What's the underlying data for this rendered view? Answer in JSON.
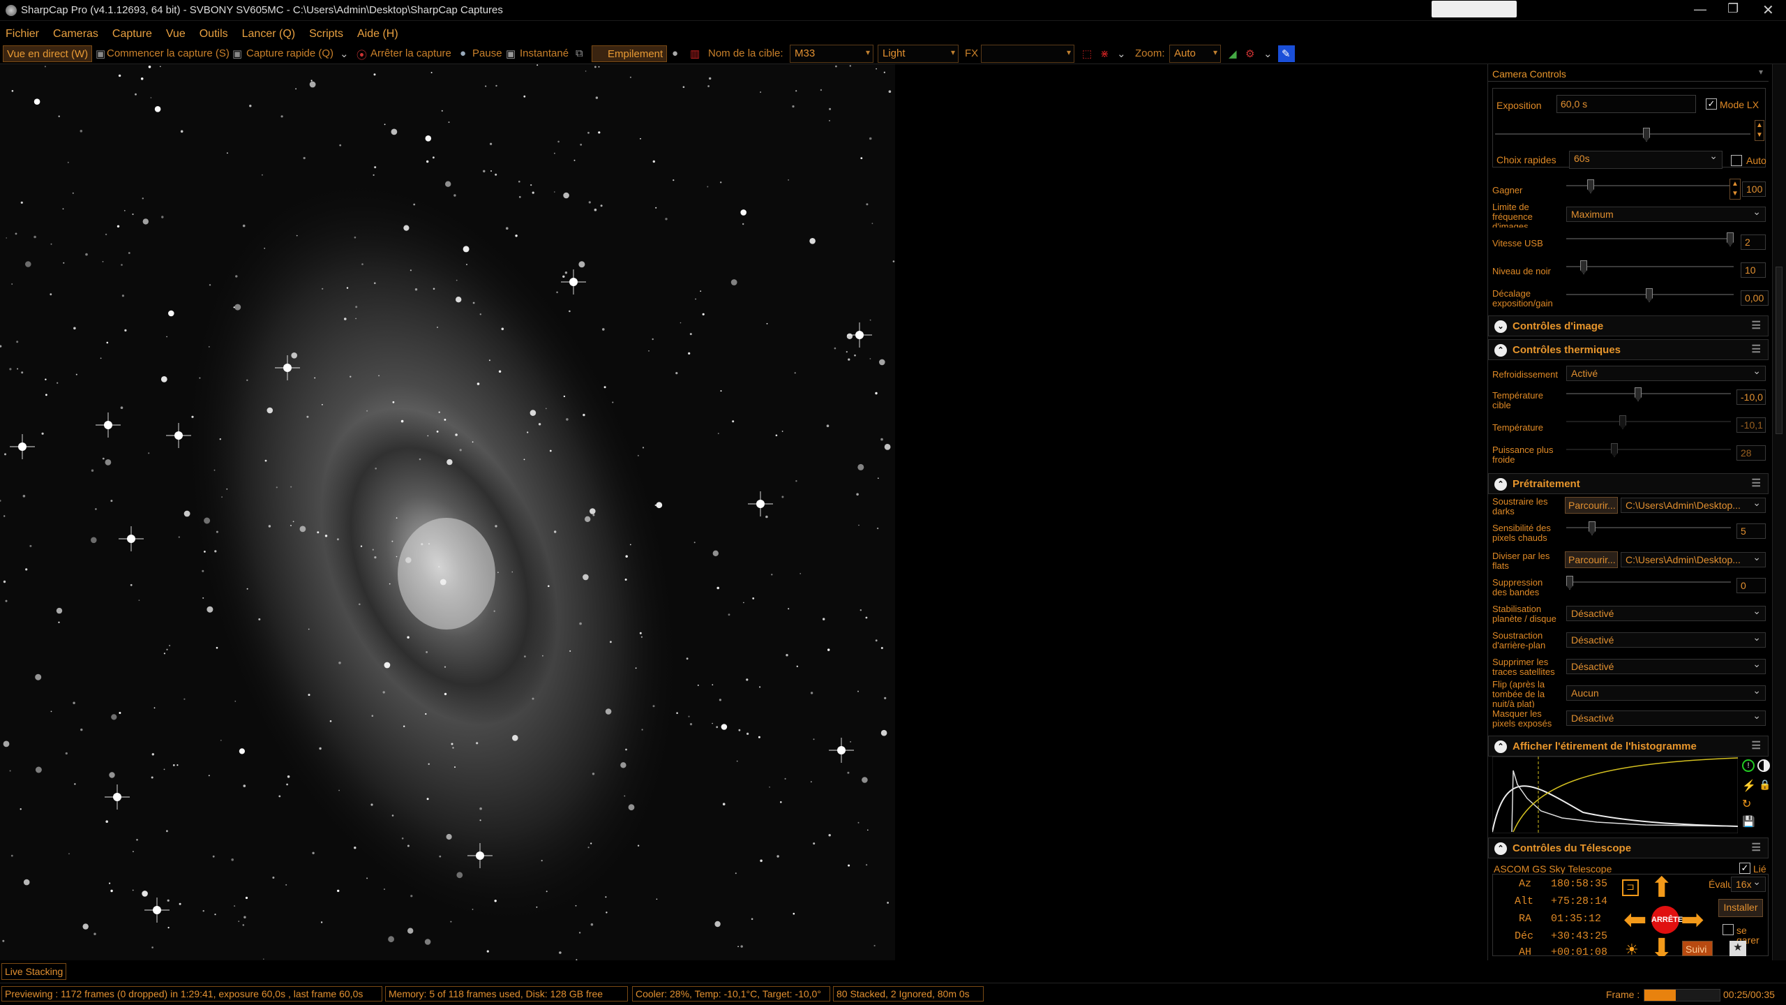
{
  "title": "SharpCap Pro (v4.1.12693, 64 bit) - SVBONY SV605MC - C:\\Users\\Admin\\Desktop\\SharpCap Captures",
  "menu": [
    "Fichier",
    "Cameras",
    "Capture",
    "Vue",
    "Outils",
    "Lancer (Q)",
    "Scripts",
    "Aide (H)"
  ],
  "toolbar": {
    "live_view": "Vue en direct (W)",
    "start_capture": "Commencer la capture (S)",
    "quick_capture": "Capture rapide (Q)",
    "stop_capture": "Arrêter la capture",
    "pause": "Pause",
    "snapshot": "Instantané",
    "stacking": "Empilement",
    "target_label": "Nom de la cible:",
    "target_value": "M33",
    "frame_type": "Light",
    "fx_label": "FX",
    "fx_value": "",
    "zoom_label": "Zoom:",
    "zoom_value": "Auto"
  },
  "live_stacking_tab": "Live Stacking",
  "panel": {
    "title": "Camera Controls",
    "exposure_label": "Exposition",
    "exposure_value": "60,0 s",
    "mode_lx": "Mode LX",
    "quick_choice_label": "Choix rapides",
    "quick_choice_value": "60s",
    "auto_label": "Auto",
    "gain_label": "Gagner",
    "gain_value": "100",
    "framerate_label": "Limite de fréquence d'images",
    "framerate_value": "Maximum",
    "usb_label": "Vitesse USB",
    "usb_value": "2",
    "black_label": "Niveau de noir",
    "black_value": "10",
    "offset_label": "Décalage exposition/gain",
    "offset_value": "0,00",
    "image_controls": "Contrôles d'image",
    "thermal_controls": "Contrôles thermiques",
    "cooling_label": "Refroidissement",
    "cooling_value": "Activé",
    "target_temp_label": "Température cible",
    "target_temp_value": "-10,0",
    "temp_label": "Température",
    "temp_value": "-10,1",
    "power_label": "Puissance plus froide",
    "power_value": "28",
    "preprocessing": "Prétraitement",
    "darks_label": "Soustraire les darks",
    "browse": "Parcourir...",
    "darks_path": "C:\\Users\\Admin\\Desktop...",
    "hotpix_label": "Sensibilité des pixels chauds",
    "hotpix_value": "5",
    "flats_label": "Diviser par les flats",
    "flats_path": "C:\\Users\\Admin\\Desktop...",
    "banding_label": "Suppression des bandes",
    "banding_value": "0",
    "stab_label": "Stabilisation planète / disque",
    "stab_value": "Désactivé",
    "bg_label": "Soustraction d'arrière-plan",
    "bg_value": "Désactivé",
    "sat_label": "Supprimer les traces satellites",
    "sat_value": "Désactivé",
    "flip_label": "Flip (après la tombée de la nuit/à plat)",
    "flip_value": "Aucun",
    "mask_label": "Masquer les pixels exposés",
    "mask_value": "Désactivé",
    "histogram": "Afficher l'étirement de l'histogramme",
    "telescope": "Contrôles du Télescope",
    "scope_name": "ASCOM GS Sky Telescope",
    "linked": "Lié",
    "az": "Az",
    "az_value": "180:58:35",
    "alt": "Alt",
    "alt_value": "+75:28:14",
    "ra": "RA",
    "ra_value": "01:35:12",
    "dec": "Déc",
    "dec_value": "+30:43:25",
    "ah": "AH",
    "ah_value": "+00:01:08",
    "rate_label": "Évaluer:",
    "rate_value": "16x",
    "install": "Installer",
    "stop": "ARRÊTE",
    "park": "se garer",
    "track": "Suivi"
  },
  "status": {
    "preview": "Previewing : 1172 frames (0 dropped) in 1:29:41, exposure 60,0s , last frame 60,0s",
    "memory": "Memory: 5 of 118 frames used, Disk: 128 GB free",
    "cooler": "Cooler: 28%, Temp: -10,1°C, Target: -10,0°",
    "stacked": "80 Stacked, 2 Ignored, 80m 0s",
    "frame_label": "Frame :",
    "frame_progress": 0.42,
    "time": "00:25/00:35"
  }
}
